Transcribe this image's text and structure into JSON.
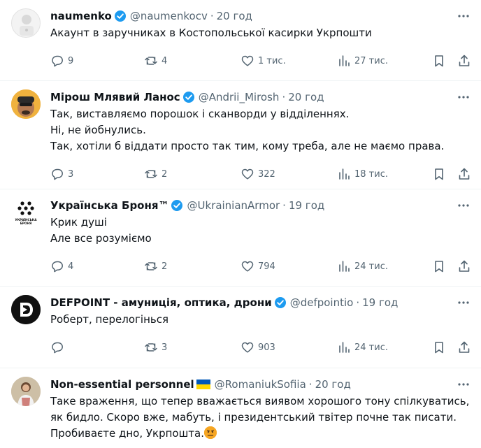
{
  "colors": {
    "verified": "#1d9bf0",
    "secondary": "#536471",
    "divider": "#eff3f4"
  },
  "tweets": [
    {
      "name": "naumenko",
      "handle": "@naumenkocv",
      "time": "20 год",
      "lines": [
        "Акаунт в заручниках в Костопольської касирки Укрпошти"
      ],
      "replies": "9",
      "retweets": "4",
      "likes": "1 тис.",
      "views": "27 тис."
    },
    {
      "name": "Мірош Млявий Ланос",
      "handle": "@Andrii_Mirosh",
      "time": "20 год",
      "lines": [
        "Так, виставляємо порошок і сканворди у відділеннях.",
        "Ні, не йобнулись.",
        "Так, хотіли б віддати просто так тим, кому треба, але не маємо права."
      ],
      "replies": "3",
      "retweets": "2",
      "likes": "322",
      "views": "18 тис."
    },
    {
      "name": "Українська Броня™",
      "handle": "@UkrainianArmor",
      "time": "19 год",
      "lines": [
        "Крик душі",
        "Але все розуміємо"
      ],
      "replies": "4",
      "retweets": "2",
      "likes": "794",
      "views": "24 тис.",
      "avatar_text": "УКРАЇНСЬКА БРОНЯ"
    },
    {
      "name": "DEFPOINT - амуниція, оптика, дрони",
      "handle": "@defpointio",
      "time": "19 год",
      "lines": [
        "Роберт, перелогінься"
      ],
      "replies": "",
      "retweets": "3",
      "likes": "903",
      "views": "24 тис."
    },
    {
      "name": "Non-essential personnel",
      "handle": "@RomaniukSofiia",
      "time": "20 год",
      "lines": [
        "Таке враження, що тепер вважається виявом хорошого тону спілкуватись,",
        "як бидло. Скоро вже, мабуть, і президентський твітер почне так писати.",
        "Пробиваєте дно, Укрпошта."
      ]
    }
  ]
}
